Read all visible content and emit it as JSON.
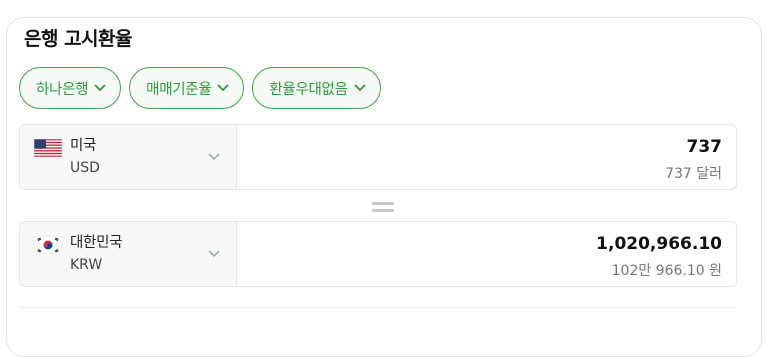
{
  "widget": {
    "title": "은행 고시환율"
  },
  "filters": [
    {
      "label": "하나은행"
    },
    {
      "label": "매매기준율"
    },
    {
      "label": "환율우대없음"
    }
  ],
  "from": {
    "country": "미국",
    "code": "USD",
    "flag_icon": "us-flag-icon",
    "amount": "737",
    "amount_text": "737 달러"
  },
  "to": {
    "country": "대한민국",
    "code": "KRW",
    "flag_icon": "kr-flag-icon",
    "amount": "1,020,966.10",
    "amount_text": "102만 966.10 원"
  },
  "colors": {
    "accent_green": "#2d9a3f",
    "chip_border": "#3aa84d",
    "border": "#e3e5e8"
  }
}
